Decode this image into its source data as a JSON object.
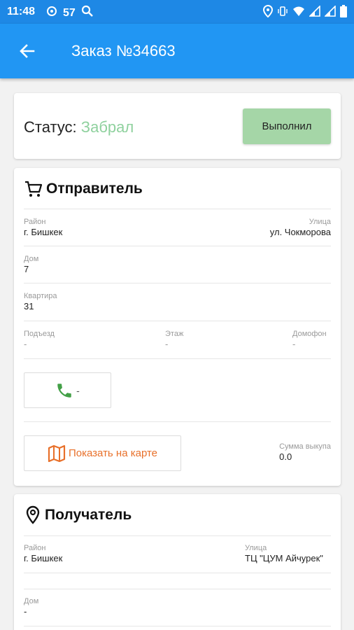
{
  "status_bar": {
    "time": "11:48",
    "signal_num": "57",
    "icons": [
      "location-icon",
      "wifi-icon",
      "signal-icon",
      "battery-icon"
    ]
  },
  "appbar": {
    "title": "Заказ №34663"
  },
  "status_card": {
    "label": "Статус:",
    "value": "Забрал",
    "done_button": "Выполнил"
  },
  "sender": {
    "header": "Отправитель",
    "district_label": "Район",
    "district": "г. Бишкек",
    "street_label": "Улица",
    "street": "ул. Чокморова",
    "house_label": "Дом",
    "house": "7",
    "apartment_label": "Квартира",
    "apartment": "31",
    "entrance_label": "Подъезд",
    "entrance": "-",
    "floor_label": "Этаж",
    "floor": "-",
    "intercom_label": "Домофон",
    "intercom": "-",
    "phone": "-",
    "map_button": "Показать на карте",
    "buyout_label": "Сумма выкупа",
    "buyout": "0.0"
  },
  "receiver": {
    "header": "Получатель",
    "district_label": "Район",
    "district": "г. Бишкек",
    "street_label": "Улица",
    "street": "ТЦ \"ЦУМ Айчурек\"",
    "house_label": "Дом",
    "house": "-"
  },
  "colors": {
    "appbar": "#2196f3",
    "status_bar": "#1e88e5",
    "status_value": "#8fd19e",
    "done_button": "#a5d6a7",
    "map_accent": "#e8702a",
    "phone_icon": "#43a047"
  }
}
